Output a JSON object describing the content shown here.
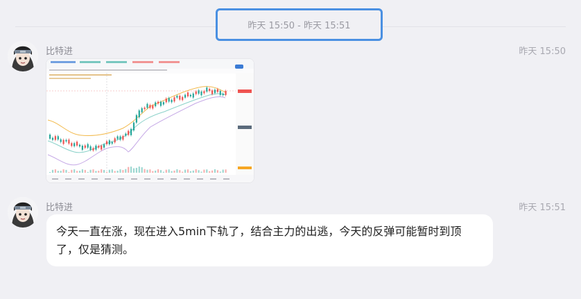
{
  "time_range": "昨天 15:50 - 昨天 15:51",
  "messages": [
    {
      "sender": "比特进",
      "time": "昨天 15:50",
      "type": "image"
    },
    {
      "sender": "比特进",
      "time": "昨天 15:51",
      "type": "text",
      "text": "今天一直在涨，现在进入5min下轨了，结合主力的出逃，今天的反弹可能暂时到顶了，仅是猜测。"
    }
  ],
  "colors": {
    "background": "#f0f0f4",
    "highlight_border": "#4a90e2",
    "bubble": "#ffffff",
    "candle_up": "#26a69a",
    "candle_down": "#ef5350"
  },
  "icons": [
    "avatar-icon"
  ]
}
